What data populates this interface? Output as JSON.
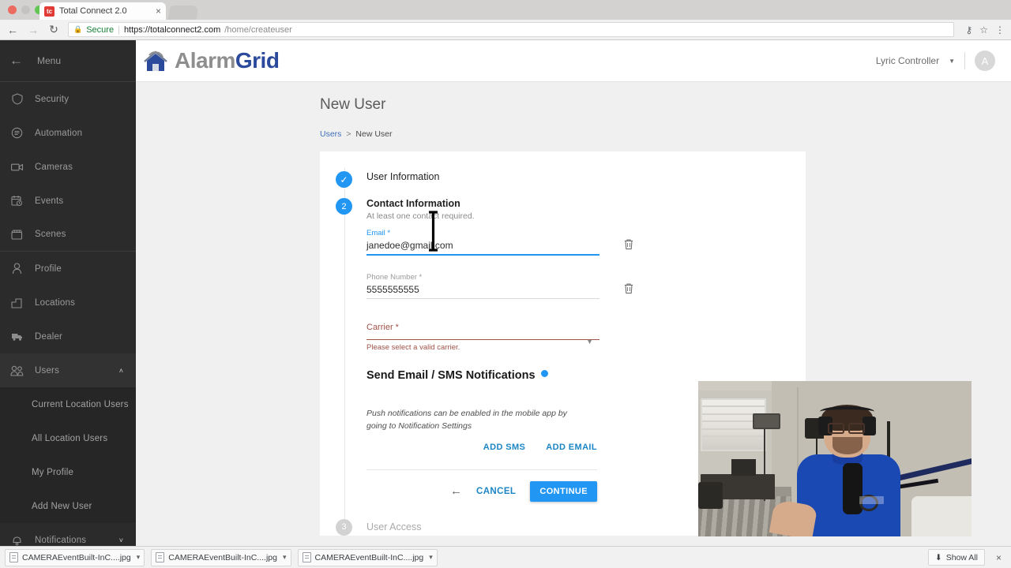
{
  "browser": {
    "tab": {
      "title": "Total Connect 2.0",
      "favicon_text": "tc",
      "close_icon": "×"
    },
    "nav": {
      "back_icon": "←",
      "forward_icon": "→",
      "reload_icon": "↻"
    },
    "omnibox": {
      "lock_icon": "🔒",
      "secure_label": "Secure",
      "url_host": "https://totalconnect2.com",
      "url_path": "/home/createuser"
    },
    "toolbar_icons": {
      "key": "⚷",
      "star": "☆",
      "menu": "⋮"
    }
  },
  "sidebar": {
    "menu_label": "Menu",
    "back_icon": "←",
    "items": [
      {
        "label": "Security",
        "icon": "shield-icon"
      },
      {
        "label": "Automation",
        "icon": "automation-icon"
      },
      {
        "label": "Cameras",
        "icon": "camera-icon"
      },
      {
        "label": "Events",
        "icon": "events-icon"
      },
      {
        "label": "Scenes",
        "icon": "scenes-icon"
      },
      {
        "label": "Profile",
        "icon": "profile-icon"
      },
      {
        "label": "Locations",
        "icon": "locations-icon"
      },
      {
        "label": "Dealer",
        "icon": "dealer-icon"
      },
      {
        "label": "Users",
        "icon": "users-icon",
        "chevron": "˄",
        "expanded": true
      },
      {
        "label": "Notifications",
        "icon": "bell-icon",
        "chevron": "˅",
        "expanded": false
      }
    ],
    "users_submenu": [
      {
        "label": "Current Location Users"
      },
      {
        "label": "All Location Users"
      },
      {
        "label": "My Profile"
      },
      {
        "label": "Add New User"
      }
    ]
  },
  "header": {
    "logo_alarm": "Alarm",
    "logo_grid": "Grid",
    "controller_name": "Lyric Controller",
    "caret": "▼",
    "avatar_initial": "A"
  },
  "page": {
    "title": "New User",
    "breadcrumb": {
      "root": "Users",
      "separator": ">",
      "current": "New User"
    }
  },
  "wizard": {
    "step1": {
      "badge": "✓",
      "title": "User Information"
    },
    "step2": {
      "badge": "2",
      "title": "Contact Information",
      "subtitle": "At least one contact required."
    },
    "step3": {
      "badge": "3",
      "title": "User Access"
    }
  },
  "form": {
    "email": {
      "label": "Email *",
      "value": "janedoe@gmail.com",
      "trash_icon": "🗑"
    },
    "phone": {
      "label": "Phone Number *",
      "value": "5555555555",
      "trash_icon": "🗑"
    },
    "carrier": {
      "label": "Carrier *",
      "value": "",
      "caret": "▼",
      "error": "Please select a valid carrier."
    }
  },
  "notifications": {
    "heading": "Send Email / SMS Notifications",
    "hint": "Push notifications can be enabled in the mobile app by going to Notification Settings",
    "add_sms": "ADD SMS",
    "add_email": "ADD EMAIL"
  },
  "actions": {
    "back_icon": "←",
    "cancel": "CANCEL",
    "continue": "CONTINUE"
  },
  "downloads": {
    "items": [
      {
        "name": "CAMERAEventBuilt-InC....jpg",
        "caret": "▾"
      },
      {
        "name": "CAMERAEventBuilt-InC....jpg",
        "caret": "▾"
      },
      {
        "name": "CAMERAEventBuilt-InC....jpg",
        "caret": "▾"
      }
    ],
    "show_all": "Show All",
    "show_all_icon": "⬇",
    "close_icon": "×"
  },
  "colors": {
    "accent_blue": "#2196f3",
    "link_blue": "#1c85c4",
    "error_red": "#a15248",
    "sidebar_bg": "#2b2b2b",
    "logo_grid_blue": "#2b4a9b"
  }
}
